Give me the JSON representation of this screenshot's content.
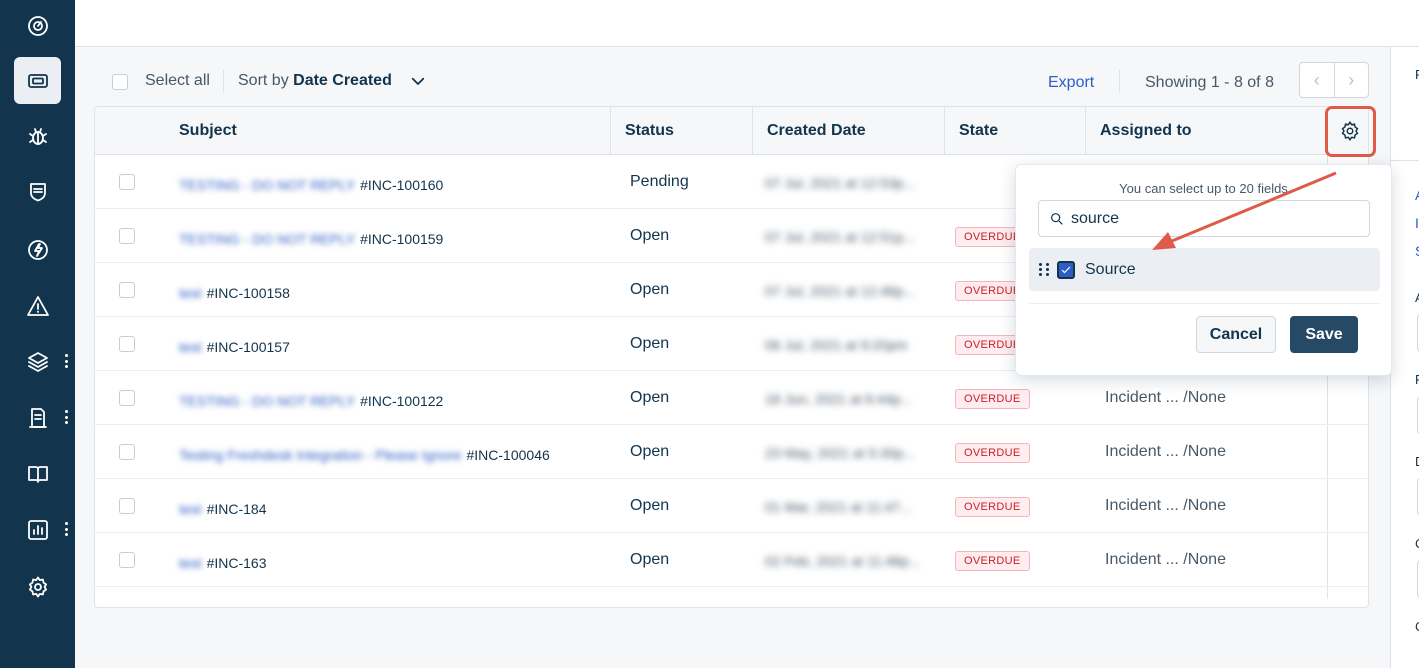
{
  "sidebar": {
    "items": [
      {
        "icon": "dashboard-icon"
      },
      {
        "icon": "tickets-icon",
        "active": true
      },
      {
        "icon": "bug-icon"
      },
      {
        "icon": "shield-icon"
      },
      {
        "icon": "lightning-icon"
      },
      {
        "icon": "warning-icon"
      },
      {
        "icon": "layers-icon"
      },
      {
        "icon": "assets-icon"
      },
      {
        "icon": "book-icon"
      },
      {
        "icon": "reports-icon"
      },
      {
        "icon": "gear-icon"
      }
    ]
  },
  "toolbar": {
    "select_all": "Select all",
    "sort_prefix": "Sort by",
    "sort_value": "Date Created",
    "export": "Export",
    "showing": "Showing 1 - 8 of 8"
  },
  "table": {
    "columns": [
      "Subject",
      "Status",
      "Created Date",
      "State",
      "Assigned to"
    ],
    "rows": [
      {
        "subject_blur": "TESTING - DO NOT REPLY",
        "id": "#INC-100160",
        "status": "Pending",
        "created": "07 Jul, 2021 at 12:53p...",
        "state": "",
        "assigned": "",
        "assigned_none": ""
      },
      {
        "subject_blur": "TESTING - DO NOT REPLY",
        "id": "#INC-100159",
        "status": "Open",
        "created": "07 Jul, 2021 at 12:51p...",
        "state": "OVERDUE",
        "assigned": "",
        "assigned_none": ""
      },
      {
        "subject_blur": "test",
        "id": "#INC-100158",
        "status": "Open",
        "created": "07 Jul, 2021 at 12:46p...",
        "state": "OVERDUE",
        "assigned": "",
        "assigned_none": ""
      },
      {
        "subject_blur": "test",
        "id": "#INC-100157",
        "status": "Open",
        "created": "06 Jul, 2021 at 9:20pm",
        "state": "OVERDUE",
        "assigned": "",
        "assigned_none": ""
      },
      {
        "subject_blur": "TESTING - DO NOT REPLY",
        "id": "#INC-100122",
        "status": "Open",
        "created": "18 Jun, 2021 at 6:44p...",
        "state": "OVERDUE",
        "assigned": "Incident ... ",
        "assigned_none": "/None"
      },
      {
        "subject_blur": "Testing Freshdesk Integration - Please Ignore",
        "id": "#INC-100046",
        "status": "Open",
        "created": "23 May, 2021 at 5:30p...",
        "state": "OVERDUE",
        "assigned": "Incident ... ",
        "assigned_none": "/None"
      },
      {
        "subject_blur": "test",
        "id": "#INC-184",
        "status": "Open",
        "created": "01 Mar, 2021 at 11:47...",
        "state": "OVERDUE",
        "assigned": "Incident ... ",
        "assigned_none": "/None"
      },
      {
        "subject_blur": "test",
        "id": "#INC-163",
        "status": "Open",
        "created": "02 Feb, 2021 at 11:48p...",
        "state": "OVERDUE",
        "assigned": "Incident ... ",
        "assigned_none": "/None"
      }
    ]
  },
  "popover": {
    "hint": "You can select up to 20 fields",
    "search_value": "source",
    "item_label": "Source",
    "item_checked": true,
    "cancel": "Cancel",
    "save": "Save"
  },
  "colors": {
    "sidebar": "#12344d",
    "accent": "#2c5cc5",
    "overdue": "#c82124",
    "highlight": "#e05a4a",
    "save_button": "#264966"
  }
}
